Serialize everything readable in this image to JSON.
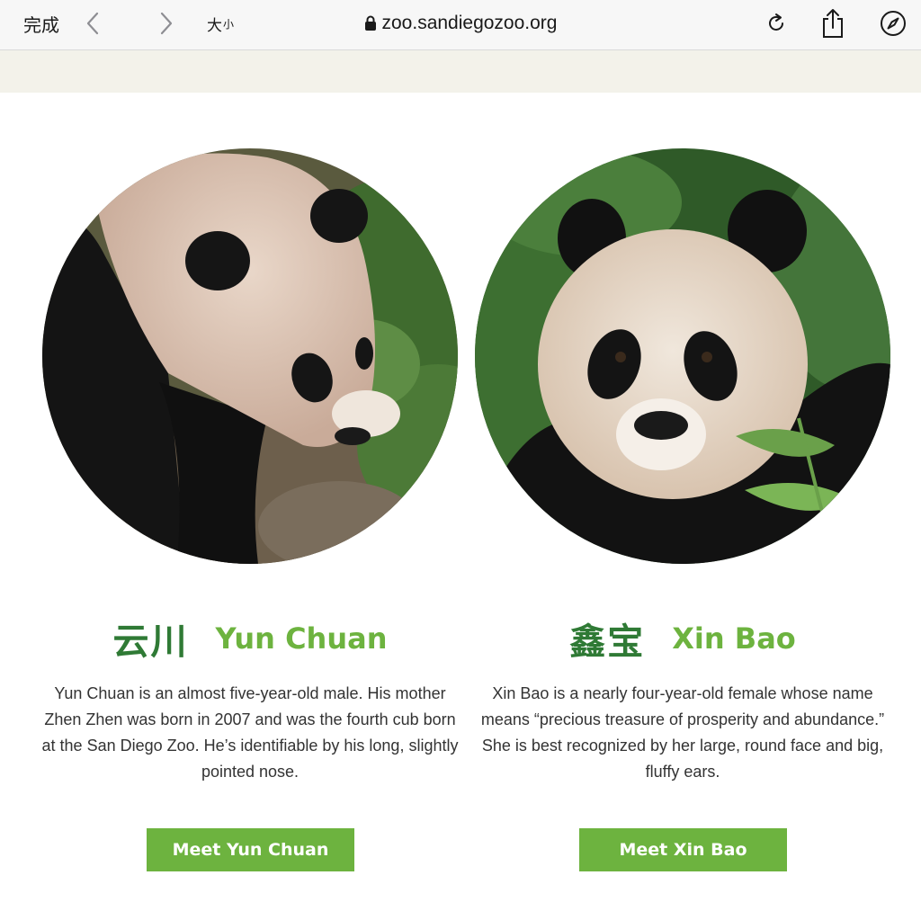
{
  "browser": {
    "done_label": "完成",
    "text_size_big": "大",
    "text_size_small": "小",
    "url": "zoo.sandiegozoo.org"
  },
  "pandas": [
    {
      "cn_name": "云川",
      "en_name": "Yun Chuan",
      "description": "Yun Chuan is an almost five-year-old male. His mother Zhen Zhen was born in 2007 and was the fourth cub born at the San Diego Zoo. He’s identifiable by his long, slightly pointed nose.",
      "button_label": "Meet Yun Chuan"
    },
    {
      "cn_name": "鑫宝",
      "en_name": "Xin Bao",
      "description": "Xin Bao is a nearly four-year-old female whose name means “precious treasure of prosperity and abundance.” She is best recognized by her large, round face and big, fluffy ears.",
      "button_label": "Meet Xin Bao"
    }
  ],
  "colors": {
    "brand_green": "#6db33f",
    "dark_green": "#2f7a35",
    "banner_beige": "#f3f2ea"
  }
}
